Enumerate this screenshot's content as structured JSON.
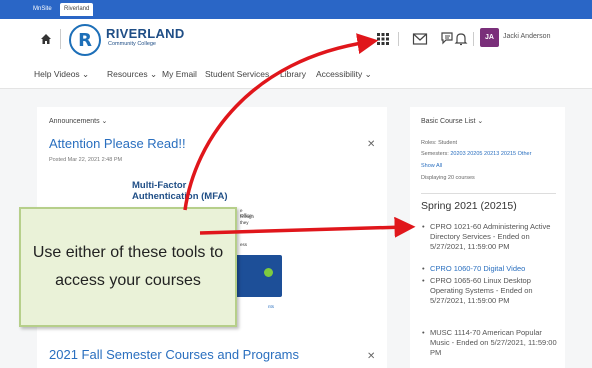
{
  "top_strip": {
    "tab_mysite": "MnSite",
    "tab_active": "Riverland"
  },
  "header": {
    "logo_name": "RIVERLAND",
    "logo_sub": "Community College",
    "logo_letter": "R",
    "avatar_initials": "JA",
    "user_name": "Jacki Anderson"
  },
  "nav": {
    "items": [
      "Help Videos ⌄",
      "Resources ⌄",
      "My Email",
      "Student Services",
      "Library",
      "Accessibility ⌄"
    ]
  },
  "announcements": {
    "title": "Announcements ⌄",
    "headline": "Attention Please Read!!",
    "posted": "Posted Mar 22, 2021 2:48 PM",
    "mfa_title": "Multi-Factor Authentication (MFA)",
    "mfa_lines": [
      "e Office",
      "hrough",
      "they",
      "ess",
      "nts"
    ],
    "second_headline": "2021 Fall Semester Courses and Programs"
  },
  "course_list": {
    "title": "Basic Course List ⌄",
    "roles": "Roles: Student",
    "semesters_label": "Semesters:",
    "semesters": "20203 20205 20213 20215 Other",
    "show_all": "Show All",
    "displaying": "Displaying 20 courses",
    "term": "Spring 2021 (20215)",
    "courses": [
      "CPRO 1021-60 Administering Active Directory Services - Ended on 5/27/2021, 11:59:00 PM",
      "CPRO 1060-70 Digital Video",
      "CPRO 1065-60 Linux Desktop Operating Systems - Ended on 5/27/2021, 11:59:00 PM",
      "MUSC 1114-70 American Popular Music - Ended on 5/27/2021, 11:59:00 PM"
    ]
  },
  "callout": {
    "text": "Use either of these tools to access your courses"
  },
  "colors": {
    "accent_blue": "#2a66c6",
    "arrow_red": "#e0161b",
    "callout_green": "#eaf2d8"
  }
}
